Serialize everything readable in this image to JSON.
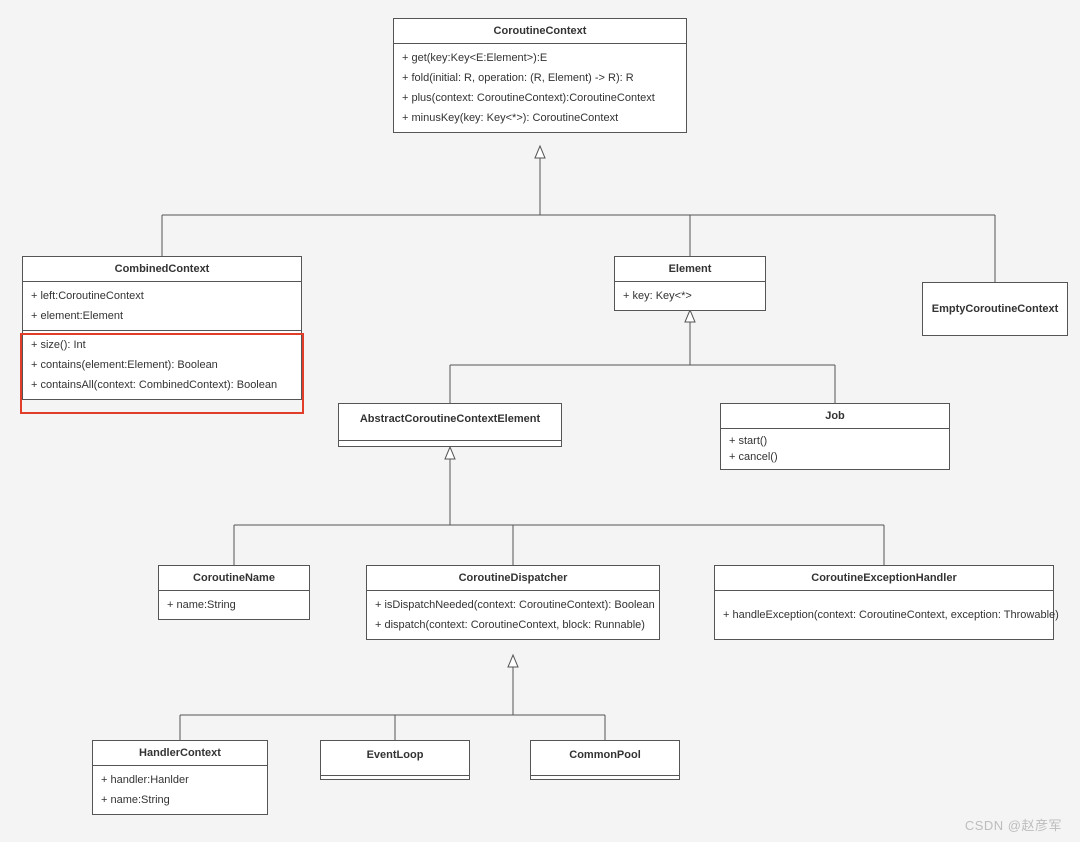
{
  "watermark": "CSDN @赵彦军",
  "classes": {
    "coroutineContext": {
      "title": "CoroutineContext",
      "methods": [
        "+ get(key:Key<E:Element>):E",
        "+ fold(initial: R, operation: (R, Element) -> R): R",
        "+ plus(context: CoroutineContext):CoroutineContext",
        "+ minusKey(key: Key<*>): CoroutineContext"
      ]
    },
    "combinedContext": {
      "title": "CombinedContext",
      "fields": [
        "+ left:CoroutineContext",
        "+ element:Element"
      ],
      "highlighted": [
        "+ size(): Int",
        "+ contains(element:Element): Boolean",
        "+ containsAll(context: CombinedContext): Boolean"
      ]
    },
    "element": {
      "title": "Element",
      "fields": [
        "+ key: Key<*>"
      ]
    },
    "emptyCoroutineContext": {
      "title": "EmptyCoroutineContext"
    },
    "abstractElement": {
      "title": "AbstractCoroutineContextElement"
    },
    "job": {
      "title": "Job",
      "fields": [
        "+ start()",
        "+ cancel()"
      ]
    },
    "coroutineName": {
      "title": "CoroutineName",
      "fields": [
        "+ name:String"
      ]
    },
    "coroutineDispatcher": {
      "title": "CoroutineDispatcher",
      "methods": [
        "+ isDispatchNeeded(context: CoroutineContext): Boolean",
        "+ dispatch(context: CoroutineContext, block: Runnable)"
      ]
    },
    "coroutineExceptionHandler": {
      "title": "CoroutineExceptionHandler",
      "methods": [
        "+ handleException(context: CoroutineContext, exception: Throwable)"
      ]
    },
    "handlerContext": {
      "title": "HandlerContext",
      "fields": [
        "+ handler:Hanlder",
        "+ name:String"
      ]
    },
    "eventLoop": {
      "title": "EventLoop"
    },
    "commonPool": {
      "title": "CommonPool"
    }
  }
}
